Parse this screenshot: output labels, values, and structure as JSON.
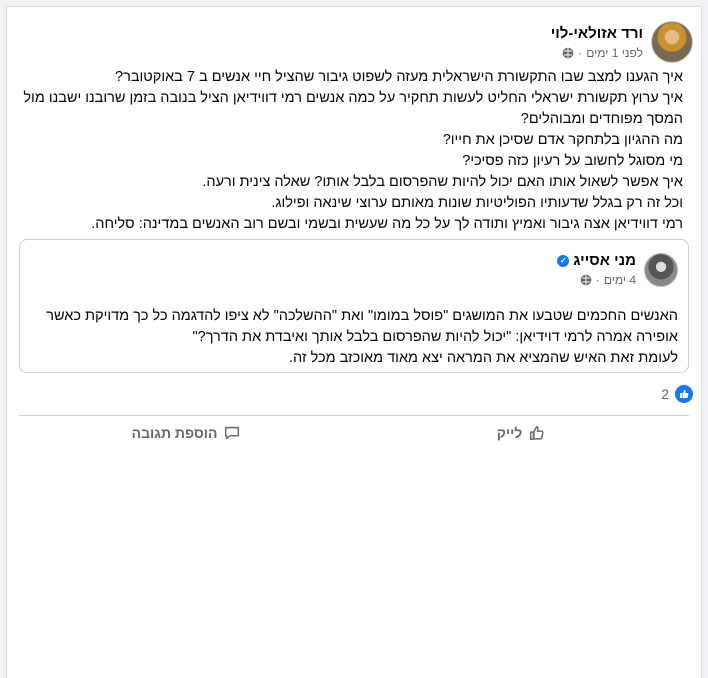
{
  "post": {
    "author": "ורד אזולאי-לוי",
    "time": "לפני 1 ימים",
    "text_lines": [
      "איך הגענו למצב שבו התקשורת הישראלית מעזה לשפוט גיבור שהציל חיי אנשים ב 7 באוקטובר?",
      "איך ערוץ תקשורת ישראלי החליט לעשות תחקיר על כמה אנשים רמי דווידיאן הציל בנובה בזמן שרובנו ישבנו מול המסך מפוחדים ומבוהלים?",
      "מה ההגיון בלתחקר אדם שסיכן את חייו?",
      "מי מסוגל לחשוב על רעיון כזה פסיכי?",
      "איך אפשר לשאול אותו האם יכול להיות שהפרסום בלבל אותו? שאלה צינית ורעה.",
      "וכל זה רק בגלל שדעותיו הפוליטיות שונות מאותם ערוצי שינאה ופילוג.",
      "רמי דווידיאן אצה גיבור ואמיץ ותודה לך על כל מה שעשית ובשמי ובשם רוב האנשים במדינה: סליחה."
    ]
  },
  "shared": {
    "author": "מני אסייג",
    "time": "4 ימים",
    "text_lines": [
      "האנשים החכמים שטבעו את המושגים \"פוסל במומו\" ואת \"ההשלכה\" לא ציפו להדגמה כל כך מדויקת כאשר אופירה אמרה לרמי דוידיאן: \"יכול להיות שהפרסום בלבל אותך ואיבדת את הדרך?\"",
      "לעומת זאת האיש שהמציא את המראה יצא מאוד מאוכזב מכל זה."
    ]
  },
  "reactions": {
    "count": "2",
    "icon": "like-icon"
  },
  "actions": {
    "like": "לייק",
    "comment": "הוספת תגובה"
  },
  "colors": {
    "accent": "#1877f2",
    "muted": "#65676b"
  }
}
